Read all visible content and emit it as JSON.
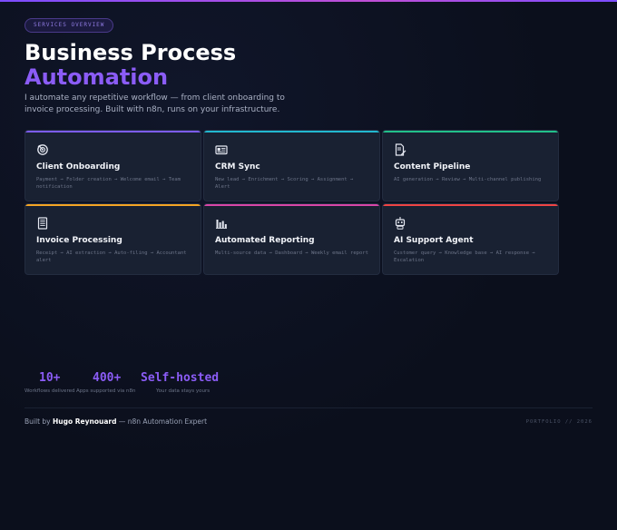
{
  "header": {
    "badge": "SERVICES OVERVIEW",
    "title_line1": "Business Process",
    "title_line2": "Automation",
    "subtitle": "I automate any repetitive workflow — from client onboarding to invoice processing. Built with n8n, runs on your infrastructure."
  },
  "services": [
    {
      "name": "Client Onboarding",
      "desc": "Payment → Folder creation → Welcome email → Team notification",
      "icon": "target-icon",
      "accent": "#7c5cf0"
    },
    {
      "name": "CRM Sync",
      "desc": "New lead → Enrichment → Scoring → Assignment → Alert",
      "icon": "id-card-icon",
      "accent": "#22b8cf"
    },
    {
      "name": "Content Pipeline",
      "desc": "AI generation → Review → Multi-channel publishing",
      "icon": "document-edit-icon",
      "accent": "#22c08a"
    },
    {
      "name": "Invoice Processing",
      "desc": "Receipt → AI extraction → Auto-filing → Accountant alert",
      "icon": "receipt-icon",
      "accent": "#f5a524"
    },
    {
      "name": "Automated Reporting",
      "desc": "Multi-source data → Dashboard → Weekly email report",
      "icon": "bar-chart-icon",
      "accent": "#d946a8"
    },
    {
      "name": "AI Support Agent",
      "desc": "Customer query → Knowledge base → AI response → Escalation",
      "icon": "robot-icon",
      "accent": "#ef4444"
    }
  ],
  "stats": [
    {
      "value": "10+",
      "label": "Workflows delivered"
    },
    {
      "value": "400+",
      "label": "Apps supported via n8n"
    },
    {
      "value": "Self-hosted",
      "label": "Your data stays yours"
    }
  ],
  "footer": {
    "built_by_prefix": "Built by",
    "author": "Hugo Reynouard",
    "built_by_suffix": "— n8n Automation Expert",
    "right": "PORTFOLIO // 2026"
  },
  "colors": {
    "background": "#0b0f1c",
    "card": "#192132",
    "accent_purple": "#8b5cf6"
  }
}
